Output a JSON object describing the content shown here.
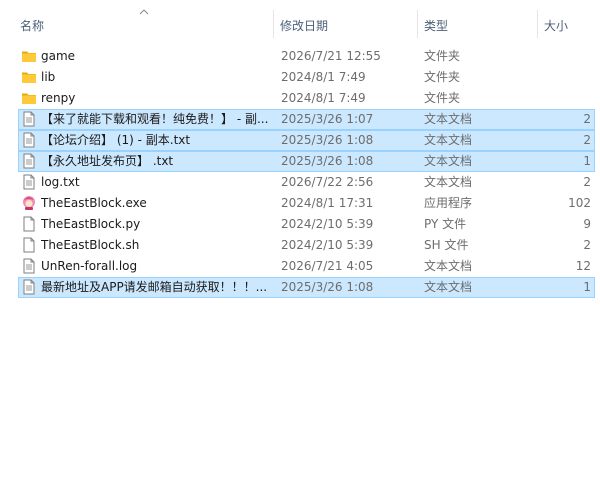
{
  "columns": {
    "name": "名称",
    "date": "修改日期",
    "type": "类型",
    "size": "大小"
  },
  "files": [
    {
      "name": "game",
      "date": "2026/7/21 12:55",
      "type": "文件夹",
      "size": "",
      "icon": "folder-icon",
      "selected": false
    },
    {
      "name": "lib",
      "date": "2024/8/1 7:49",
      "type": "文件夹",
      "size": "",
      "icon": "folder-icon",
      "selected": false
    },
    {
      "name": "renpy",
      "date": "2024/8/1 7:49",
      "type": "文件夹",
      "size": "",
      "icon": "folder-icon",
      "selected": false
    },
    {
      "name": "【来了就能下载和观看！纯免费！】 - 副...",
      "date": "2025/3/26 1:07",
      "type": "文本文档",
      "size": "2",
      "icon": "text-file-icon",
      "selected": true
    },
    {
      "name": "【论坛介绍】 (1) - 副本.txt",
      "date": "2025/3/26 1:08",
      "type": "文本文档",
      "size": "2",
      "icon": "text-file-icon",
      "selected": true
    },
    {
      "name": "【永久地址发布页】 .txt",
      "date": "2025/3/26 1:08",
      "type": "文本文档",
      "size": "1",
      "icon": "text-file-icon",
      "selected": true
    },
    {
      "name": "log.txt",
      "date": "2026/7/22 2:56",
      "type": "文本文档",
      "size": "2",
      "icon": "text-file-icon",
      "selected": false
    },
    {
      "name": "TheEastBlock.exe",
      "date": "2024/8/1 17:31",
      "type": "应用程序",
      "size": "102",
      "icon": "app-exe-icon",
      "selected": false
    },
    {
      "name": "TheEastBlock.py",
      "date": "2024/2/10 5:39",
      "type": "PY 文件",
      "size": "9",
      "icon": "blank-file-icon",
      "selected": false
    },
    {
      "name": "TheEastBlock.sh",
      "date": "2024/2/10 5:39",
      "type": "SH 文件",
      "size": "2",
      "icon": "blank-file-icon",
      "selected": false
    },
    {
      "name": "UnRen-forall.log",
      "date": "2026/7/21 4:05",
      "type": "文本文档",
      "size": "12",
      "icon": "text-file-icon",
      "selected": false
    },
    {
      "name": "最新地址及APP请发邮箱自动获取！！！...",
      "date": "2025/3/26 1:08",
      "type": "文本文档",
      "size": "1",
      "icon": "text-file-icon",
      "selected": true
    }
  ],
  "colors": {
    "selection_bg": "#cce8ff",
    "selection_border": "#99d1ff",
    "header_text": "#4c607a",
    "folder": "#ffca3a"
  }
}
